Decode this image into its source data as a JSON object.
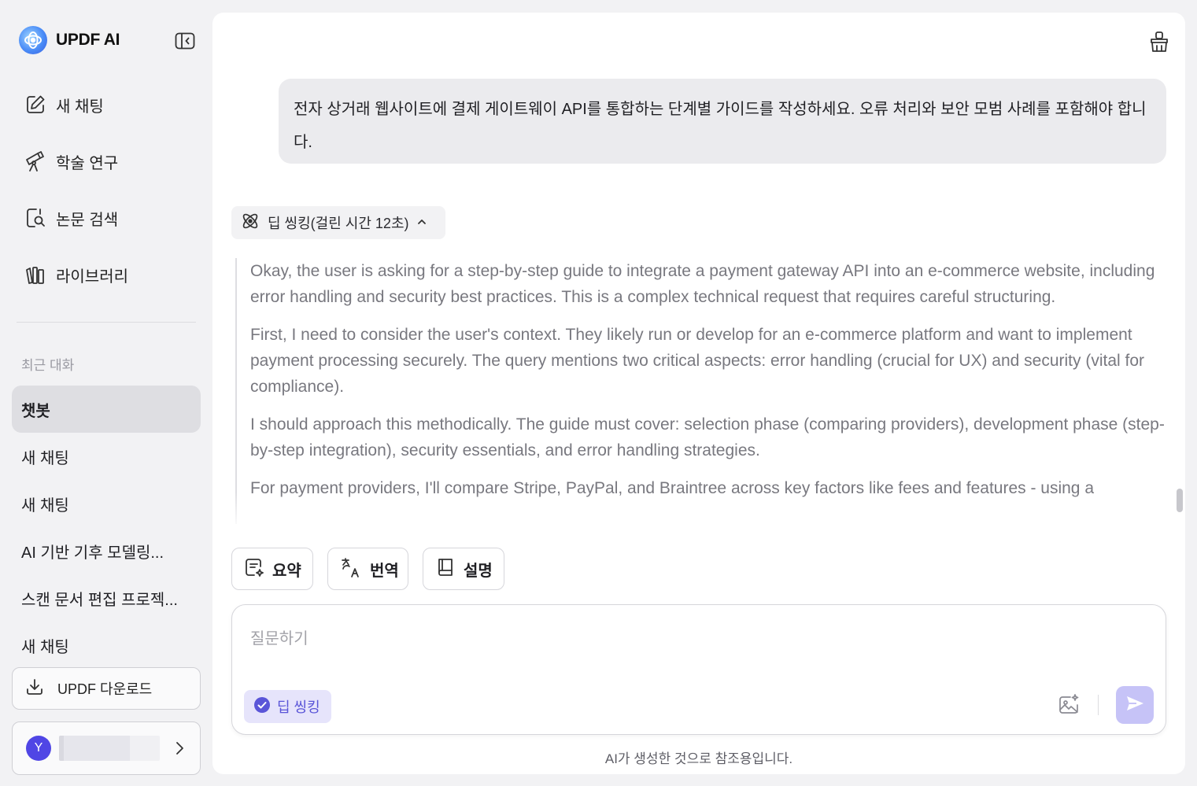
{
  "app": {
    "name": "UPDF AI"
  },
  "sidebar": {
    "nav": [
      {
        "label": "새 채팅",
        "icon": "new-chat-icon"
      },
      {
        "label": "학술 연구",
        "icon": "telescope-icon"
      },
      {
        "label": "논문 검색",
        "icon": "paper-search-icon"
      },
      {
        "label": "라이브러리",
        "icon": "library-icon"
      }
    ],
    "recent_title": "최근 대화",
    "recent": [
      "챗봇",
      "새 채팅",
      "새 채팅",
      "AI 기반 기후 모델링...",
      "스캔 문서 편집 프로젝...",
      "새 채팅"
    ],
    "active_recent_index": 0,
    "download_label": "UPDF 다운로드",
    "user": {
      "initial": "Y"
    }
  },
  "chat": {
    "user_message": "전자 상거래 웹사이트에 결제 게이트웨이 API를 통합하는 단계별 가이드를 작성하세요. 오류 처리와 보안 모범 사례를 포함해야 합니다.",
    "thinking_label": "딥 씽킹(걸린 시간 12초)",
    "thinking": [
      "Okay, the user is asking for a step-by-step guide to integrate a payment gateway API into an e-commerce website, including error handling and security best practices. This is a complex technical request that requires careful structuring.",
      "First, I need to consider the user's context. They likely run or develop for an e-commerce platform and want to implement payment processing securely. The query mentions two critical aspects: error handling (crucial for UX) and security (vital for compliance).",
      "I should approach this methodically. The guide must cover: selection phase (comparing providers), development phase (step-by-step integration), security essentials, and error handling strategies.",
      "For payment providers, I'll compare Stripe, PayPal, and Braintree across key factors like fees and features - using a"
    ]
  },
  "actions": [
    {
      "label": "요약",
      "icon": "summarize-icon"
    },
    {
      "label": "번역",
      "icon": "translate-icon"
    },
    {
      "label": "설명",
      "icon": "explain-book-icon"
    }
  ],
  "composer": {
    "placeholder": "질문하기",
    "deep_thinking_label": "딥 씽킹"
  },
  "footer": {
    "disclaimer": "AI가 생성한 것으로 참조용입니다."
  },
  "colors": {
    "accent": "#5a55d8",
    "send_button": "#c6c3f7",
    "chip_bg": "#e6e4fb"
  }
}
